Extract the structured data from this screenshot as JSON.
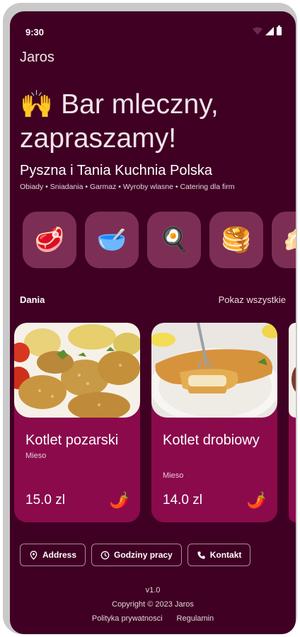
{
  "status_bar": {
    "time": "9:30"
  },
  "app": {
    "title": "Jaros"
  },
  "hero": {
    "emoji": "🙌",
    "title": "Bar mleczny, zapraszamy!",
    "subtitle": "Pyszna i Tania Kuchnia Polska",
    "tags": "Obiady • Sniadania • Garmaz • Wyroby wlasne • Catering dla firm"
  },
  "categories": [
    {
      "icon": "meat-icon",
      "glyph": "🥩"
    },
    {
      "icon": "bowl-icon",
      "glyph": "🥣"
    },
    {
      "icon": "egg-pan-icon",
      "glyph": "🍳"
    },
    {
      "icon": "pancakes-icon",
      "glyph": "🥞"
    },
    {
      "icon": "dumpling-icon",
      "glyph": "🥟"
    }
  ],
  "section": {
    "title": "Dania",
    "see_all": "Pokaz wszystkie"
  },
  "dishes": [
    {
      "name": "Kotlet pozarski",
      "category": "Mieso",
      "price": "15.0 zl",
      "icon": "chili-icon",
      "glyph": "🌶️"
    },
    {
      "name": "Kotlet drobiowy",
      "category": "Mieso",
      "price": "14.0 zl",
      "icon": "chili-icon",
      "glyph": "🌶️"
    }
  ],
  "actions": [
    {
      "label": "Address",
      "icon": "location-pin-icon"
    },
    {
      "label": "Godziny pracy",
      "icon": "clock-icon"
    },
    {
      "label": "Kontakt",
      "icon": "phone-icon"
    }
  ],
  "footer": {
    "version": "v1.0",
    "copyright": "Copyright © 2023 Jaros",
    "privacy": "Polityka prywatnosci",
    "terms": "Regulamin"
  }
}
